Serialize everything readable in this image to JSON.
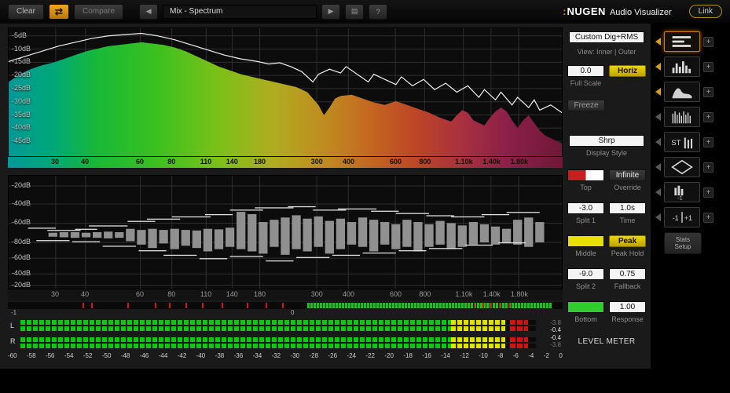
{
  "toolbar": {
    "clear": "Clear",
    "compare": "Compare",
    "preset": "Mix - Spectrum",
    "brand_prefix": ":",
    "brand_name": "NUGEN",
    "brand_suffix": "Audio Visualizer",
    "link": "Link",
    "icons": {
      "swap": "⇄",
      "prev": "◀",
      "play": "▶",
      "list": "▤",
      "help": "?"
    }
  },
  "freq_ticks": [
    {
      "label": "30",
      "x": 8.5
    },
    {
      "label": "40",
      "x": 13.9
    },
    {
      "label": "60",
      "x": 23.8
    },
    {
      "label": "80",
      "x": 29.5
    },
    {
      "label": "110",
      "x": 35.7
    },
    {
      "label": "140",
      "x": 40.4
    },
    {
      "label": "180",
      "x": 45.4
    },
    {
      "label": "300",
      "x": 55.7
    },
    {
      "label": "400",
      "x": 61.4
    },
    {
      "label": "600",
      "x": 69.9
    },
    {
      "label": "800",
      "x": 75.2
    },
    {
      "label": "1.10k",
      "x": 82.2
    },
    {
      "label": "1.40k",
      "x": 87.2
    },
    {
      "label": "1.80k",
      "x": 92.2
    }
  ],
  "spectrum_panel": {
    "db_labels": [
      "-5dB",
      "-10dB",
      "-15dB",
      "-20dB",
      "-25dB",
      "-30dB",
      "-35dB",
      "-40dB",
      "-45dB"
    ],
    "db_label_pos": [
      6,
      16.3,
      26.6,
      36.9,
      47.2,
      57.5,
      67.8,
      78.1,
      88.4
    ],
    "gradient": [
      [
        0,
        "#009898"
      ],
      [
        8,
        "#00a878"
      ],
      [
        16,
        "#18b838"
      ],
      [
        26,
        "#38c020"
      ],
      [
        38,
        "#7cc018"
      ],
      [
        48,
        "#b0ac20"
      ],
      [
        58,
        "#c08820"
      ],
      [
        66,
        "#c46420"
      ],
      [
        74,
        "#bc4428"
      ],
      [
        82,
        "#a83040"
      ],
      [
        90,
        "#8c2048"
      ],
      [
        100,
        "#701838"
      ]
    ],
    "fill_points": [
      [
        0,
        42
      ],
      [
        2,
        36
      ],
      [
        4,
        32
      ],
      [
        6,
        29
      ],
      [
        8,
        27
      ],
      [
        10,
        24
      ],
      [
        12,
        21
      ],
      [
        14,
        18
      ],
      [
        16,
        16
      ],
      [
        18,
        14
      ],
      [
        20,
        13
      ],
      [
        22,
        12
      ],
      [
        24,
        11
      ],
      [
        26,
        12
      ],
      [
        28,
        13
      ],
      [
        30,
        15
      ],
      [
        32,
        18
      ],
      [
        34,
        22
      ],
      [
        36,
        26
      ],
      [
        38,
        30
      ],
      [
        40,
        33
      ],
      [
        42,
        36
      ],
      [
        44,
        38
      ],
      [
        46,
        40
      ],
      [
        48,
        42
      ],
      [
        50,
        44
      ],
      [
        52,
        46
      ],
      [
        54,
        50
      ],
      [
        56,
        60
      ],
      [
        57,
        68
      ],
      [
        58,
        62
      ],
      [
        59,
        55
      ],
      [
        60,
        53
      ],
      [
        62,
        52
      ],
      [
        64,
        55
      ],
      [
        66,
        58
      ],
      [
        68,
        60
      ],
      [
        70,
        57
      ],
      [
        72,
        60
      ],
      [
        74,
        63
      ],
      [
        76,
        66
      ],
      [
        78,
        70
      ],
      [
        80,
        73
      ],
      [
        81,
        68
      ],
      [
        82,
        64
      ],
      [
        83,
        66
      ],
      [
        84,
        72
      ],
      [
        86,
        76
      ],
      [
        87,
        70
      ],
      [
        88,
        65
      ],
      [
        89,
        62
      ],
      [
        90,
        65
      ],
      [
        91,
        72
      ],
      [
        92,
        78
      ],
      [
        93,
        72
      ],
      [
        94,
        68
      ],
      [
        95,
        74
      ],
      [
        96,
        80
      ],
      [
        97,
        84
      ],
      [
        98,
        86
      ],
      [
        100,
        90
      ]
    ],
    "peak_line": [
      [
        0,
        26
      ],
      [
        3,
        22
      ],
      [
        6,
        18
      ],
      [
        9,
        14
      ],
      [
        12,
        11
      ],
      [
        15,
        8
      ],
      [
        18,
        6
      ],
      [
        21,
        5
      ],
      [
        24,
        4
      ],
      [
        27,
        6
      ],
      [
        30,
        9
      ],
      [
        33,
        13
      ],
      [
        36,
        17
      ],
      [
        39,
        21
      ],
      [
        42,
        24
      ],
      [
        45,
        26
      ],
      [
        47,
        28
      ],
      [
        49,
        27
      ],
      [
        51,
        30
      ],
      [
        53,
        34
      ],
      [
        55,
        42
      ],
      [
        56,
        36
      ],
      [
        58,
        32
      ],
      [
        60,
        35
      ],
      [
        61,
        30
      ],
      [
        63,
        36
      ],
      [
        65,
        42
      ],
      [
        66,
        36
      ],
      [
        68,
        40
      ],
      [
        70,
        44
      ],
      [
        71,
        38
      ],
      [
        73,
        45
      ],
      [
        75,
        40
      ],
      [
        77,
        48
      ],
      [
        79,
        43
      ],
      [
        81,
        50
      ],
      [
        83,
        45
      ],
      [
        85,
        54
      ],
      [
        86,
        48
      ],
      [
        88,
        56
      ],
      [
        89,
        50
      ],
      [
        91,
        60
      ],
      [
        92,
        54
      ],
      [
        94,
        62
      ],
      [
        95,
        56
      ],
      [
        96,
        64
      ],
      [
        98,
        60
      ],
      [
        100,
        66
      ]
    ]
  },
  "bars_panel": {
    "db_labels": [
      "-20dB",
      "-40dB",
      "-60dB",
      "-80dB",
      "-60dB",
      "-40dB",
      "-20dB"
    ],
    "db_label_pos": [
      9,
      25,
      42,
      59,
      73,
      87,
      97
    ],
    "center": 52,
    "bars": [
      [
        8,
        1.5,
        2
      ],
      [
        10,
        2,
        2.5
      ],
      [
        12,
        2,
        3
      ],
      [
        14,
        1.5,
        2.5
      ],
      [
        16,
        2,
        3
      ],
      [
        18,
        2.5,
        3.5
      ],
      [
        20,
        2,
        3
      ],
      [
        22,
        5,
        6
      ],
      [
        24,
        4,
        9
      ],
      [
        26,
        5,
        12
      ],
      [
        28,
        4,
        8
      ],
      [
        30,
        5,
        13
      ],
      [
        32,
        4,
        10
      ],
      [
        34,
        3.5,
        12
      ],
      [
        36,
        5,
        15
      ],
      [
        38,
        4.5,
        13
      ],
      [
        40,
        6,
        11
      ],
      [
        42,
        20,
        13
      ],
      [
        44,
        18,
        15
      ],
      [
        46,
        11,
        17
      ],
      [
        48,
        13,
        11
      ],
      [
        50,
        15,
        18
      ],
      [
        52,
        17,
        13
      ],
      [
        54,
        14,
        15
      ],
      [
        56,
        16,
        11
      ],
      [
        58,
        12,
        17
      ],
      [
        60,
        14,
        13
      ],
      [
        62,
        11,
        9
      ],
      [
        64,
        15,
        11
      ],
      [
        66,
        13,
        15
      ],
      [
        68,
        11,
        9
      ],
      [
        70,
        9,
        13
      ],
      [
        72,
        13,
        11
      ],
      [
        74,
        11,
        15
      ],
      [
        76,
        9,
        11
      ],
      [
        78,
        12,
        9
      ],
      [
        80,
        10,
        13
      ],
      [
        82,
        8,
        11
      ],
      [
        84,
        11,
        9
      ],
      [
        86,
        9,
        7
      ],
      [
        88,
        7,
        9
      ],
      [
        90,
        5,
        7
      ],
      [
        92,
        13,
        9
      ],
      [
        94,
        15,
        11
      ],
      [
        96,
        11,
        7
      ]
    ],
    "dashes": [
      [
        6,
        46,
        5
      ],
      [
        10,
        48,
        6
      ],
      [
        14,
        47,
        4
      ],
      [
        18,
        44,
        7
      ],
      [
        24,
        40,
        5
      ],
      [
        28,
        38,
        6
      ],
      [
        33,
        36,
        7
      ],
      [
        38,
        34,
        5
      ],
      [
        43,
        30,
        6
      ],
      [
        48,
        28,
        7
      ],
      [
        53,
        27,
        5
      ],
      [
        58,
        30,
        6
      ],
      [
        63,
        29,
        7
      ],
      [
        68,
        31,
        5
      ],
      [
        73,
        33,
        6
      ],
      [
        78,
        35,
        5
      ],
      [
        83,
        36,
        6
      ],
      [
        88,
        34,
        5
      ],
      [
        93,
        32,
        6
      ],
      [
        8,
        57,
        6
      ],
      [
        14,
        58,
        5
      ],
      [
        20,
        62,
        6
      ],
      [
        26,
        66,
        5
      ],
      [
        31,
        70,
        6
      ],
      [
        37,
        73,
        5
      ],
      [
        43,
        71,
        6
      ],
      [
        49,
        75,
        5
      ],
      [
        55,
        72,
        6
      ],
      [
        61,
        70,
        5
      ],
      [
        67,
        68,
        6
      ],
      [
        73,
        66,
        5
      ],
      [
        79,
        64,
        6
      ],
      [
        85,
        61,
        5
      ],
      [
        91,
        59,
        5
      ]
    ]
  },
  "strip_meter": {
    "neg_label": "-1",
    "zero_label": "0",
    "green_start": 54,
    "green_end": 98,
    "red_ticks": [
      13.5,
      15,
      21.5,
      26.5,
      29,
      32,
      35,
      38.5,
      43,
      46.5,
      49.5,
      84,
      85.5,
      87,
      88.5,
      90.2
    ]
  },
  "level_meter": {
    "channel_labels": [
      "L",
      "R"
    ],
    "readouts": [
      {
        "value": "-3.8",
        "dim": true
      },
      {
        "value": "-0.4",
        "dim": false
      },
      {
        "value": "-0.4",
        "dim": false
      },
      {
        "value": "-3.8",
        "dim": true
      }
    ],
    "segments": {
      "green_end": 83.5,
      "yellow_end": 94,
      "red_start": 95,
      "red_end": 98.5
    },
    "scale_labels": [
      "-60",
      "-58",
      "-56",
      "-54",
      "-52",
      "-50",
      "-48",
      "-46",
      "-44",
      "-42",
      "-40",
      "-38",
      "-36",
      "-34",
      "-32",
      "-30",
      "-28",
      "-26",
      "-24",
      "-22",
      "-20",
      "-18",
      "-16",
      "-14",
      "-12",
      "-10",
      "-8",
      "-6",
      "-4",
      "-2",
      "0"
    ]
  },
  "controls": {
    "preset": "Custom Dig+RMS",
    "view_label": "View: Inner | Outer",
    "full_scale_value": "0.0",
    "horiz": "Horiz",
    "full_scale_label": "Full Scale",
    "freeze": "Freeze",
    "display_style_value": "Shrp",
    "display_style_label": "Display Style",
    "infinite": "Infinite",
    "top_label": "Top",
    "override_label": "Override",
    "split1_value": "-3.0",
    "time_value": "1.0s",
    "split1_label": "Split 1",
    "time_label": "Time",
    "peak": "Peak",
    "middle_label": "Middle",
    "peak_hold_label": "Peak Hold",
    "split2_value": "-9.0",
    "fallback_value": "0.75",
    "split2_label": "Split 2",
    "fallback_label": "Fallback",
    "response_value": "1.00",
    "bottom_label": "Bottom",
    "response_label": "Response",
    "meter_title": "LEVEL METER",
    "swatch_colors": {
      "top": [
        "#c42020",
        "#ffffff"
      ],
      "middle": "#e8e000",
      "bottom": "#30cc30"
    }
  },
  "modes": {
    "add_label": "+",
    "stats_setup": "Stats\nSetup",
    "items": [
      {
        "name": "level-meter",
        "selected": true,
        "active": true
      },
      {
        "name": "histogram",
        "selected": false,
        "active": true
      },
      {
        "name": "spectrum",
        "selected": false,
        "active": true
      },
      {
        "name": "spectrogram",
        "selected": false,
        "active": false
      },
      {
        "name": "stereo-meter",
        "selected": false,
        "active": false
      },
      {
        "name": "vectorscope",
        "selected": false,
        "active": false
      },
      {
        "name": "mini-meter",
        "selected": false,
        "active": false
      },
      {
        "name": "correlation",
        "selected": false,
        "active": false
      }
    ]
  }
}
